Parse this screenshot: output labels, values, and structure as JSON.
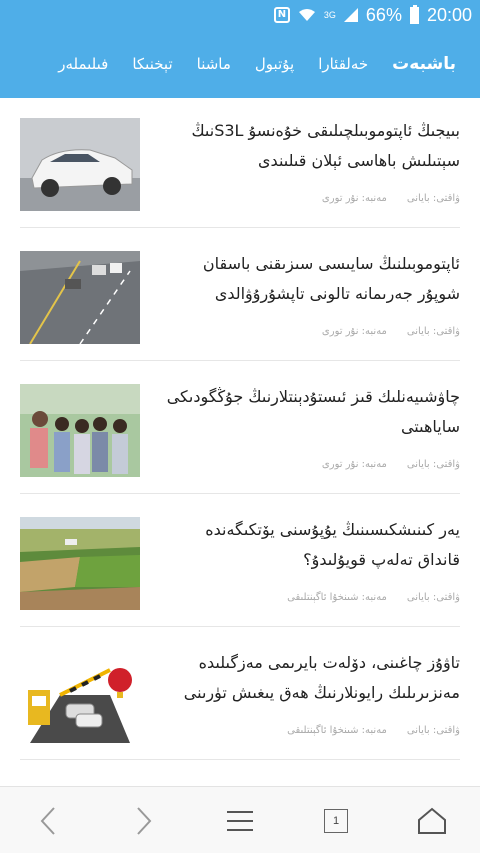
{
  "status": {
    "net": "3G",
    "battery": "66%",
    "time": "20:00"
  },
  "tabs": [
    {
      "label": "باشبەت"
    },
    {
      "label": "خەلقئارا"
    },
    {
      "label": "پۇتبول"
    },
    {
      "label": "ماشنا"
    },
    {
      "label": "تېخنىكا"
    },
    {
      "label": "فىلىملەر"
    }
  ],
  "articles": [
    {
      "title": "بىيجىڭ ئاپتوموبىلچىلىقى خۇەنسۇ S3Lنىڭ سېتىلىش باھاسى ئېلان قىلىندى",
      "meta_source": "ۋاقتى: بايانى",
      "meta_label": "مەنبە: نۇر تورى"
    },
    {
      "title": "ئاپتوموبىلنىڭ سايىسى سىزىقنى باسقان شوپۇر جەرىمانە تالونى تاپشۇرۇۋالدى",
      "meta_source": "ۋاقتى: بايانى",
      "meta_label": "مەنبە: نۇر تورى"
    },
    {
      "title": "چاۋشىيەنلىك قىز ئىستۇدېنتلارنىڭ جۇڭگودىكى ساياھىتى",
      "meta_source": "ۋاقتى: بايانى",
      "meta_label": "مەنبە: نۇر تورى"
    },
    {
      "title": "يەر كىنىشكىسىنىڭ يۇپۇسنى يۆتكىگەندە قانداق تەلەپ قويۇلىدۇ؟",
      "meta_source": "ۋاقتى: بايانى",
      "meta_label": "مەنبە: شىنخۇا ئاگېنتلىقى"
    },
    {
      "title": "تاۋۇز چاغىنى، دۆلەت بايرىمى مەزگىلىدە مەنزىرىلىك رايونلارنىڭ ھەق يىغىش تۈرىنى",
      "meta_source": "ۋاقتى: بايانى",
      "meta_label": "مەنبە: شىنخۇا ئاگېنتلىقى"
    }
  ],
  "bottom": {
    "tab_count": "1"
  }
}
